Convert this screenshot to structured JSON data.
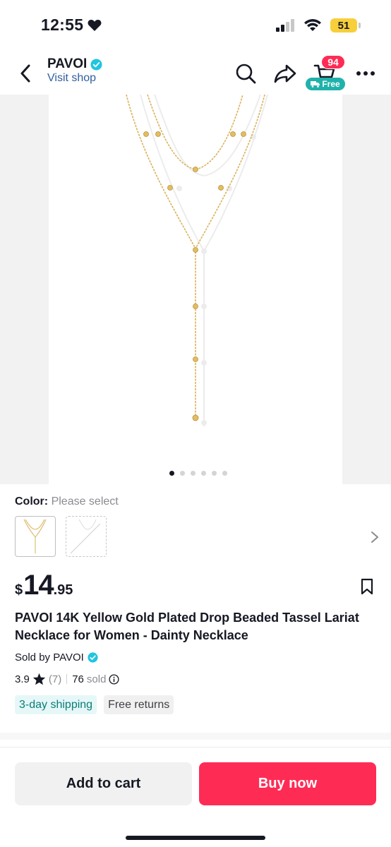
{
  "status_bar": {
    "time": "12:55",
    "battery": "51",
    "heart_icon": "heart-icon"
  },
  "header": {
    "shop_name": "PAVOI",
    "visit_shop": "Visit shop",
    "cart_count": "94",
    "free_label": "Free",
    "icons": [
      "back-icon",
      "verified-icon",
      "search-icon",
      "share-icon",
      "cart-icon",
      "more-icon"
    ]
  },
  "gallery": {
    "image_count": 6,
    "active_index": 0
  },
  "color": {
    "label": "Color:",
    "value": "Please select"
  },
  "price": {
    "currency": "$",
    "integer": "14",
    "decimal": ".95"
  },
  "product": {
    "title": "PAVOI 14K Yellow Gold Plated Drop Beaded Tassel Lariat Necklace for Women - Dainty Necklace",
    "sold_by": "Sold by PAVOI",
    "rating": "3.9",
    "review_count": "(7)",
    "sold": "76",
    "sold_label": "sold"
  },
  "tags": {
    "shipping": "3-day shipping",
    "returns": "Free returns"
  },
  "actions": {
    "add_to_cart": "Add to cart",
    "buy_now": "Buy now"
  },
  "colors": {
    "accent": "#fe2c55",
    "teal": "#20b2aa",
    "verified": "#20c5e0",
    "link": "#2f5f9e"
  }
}
